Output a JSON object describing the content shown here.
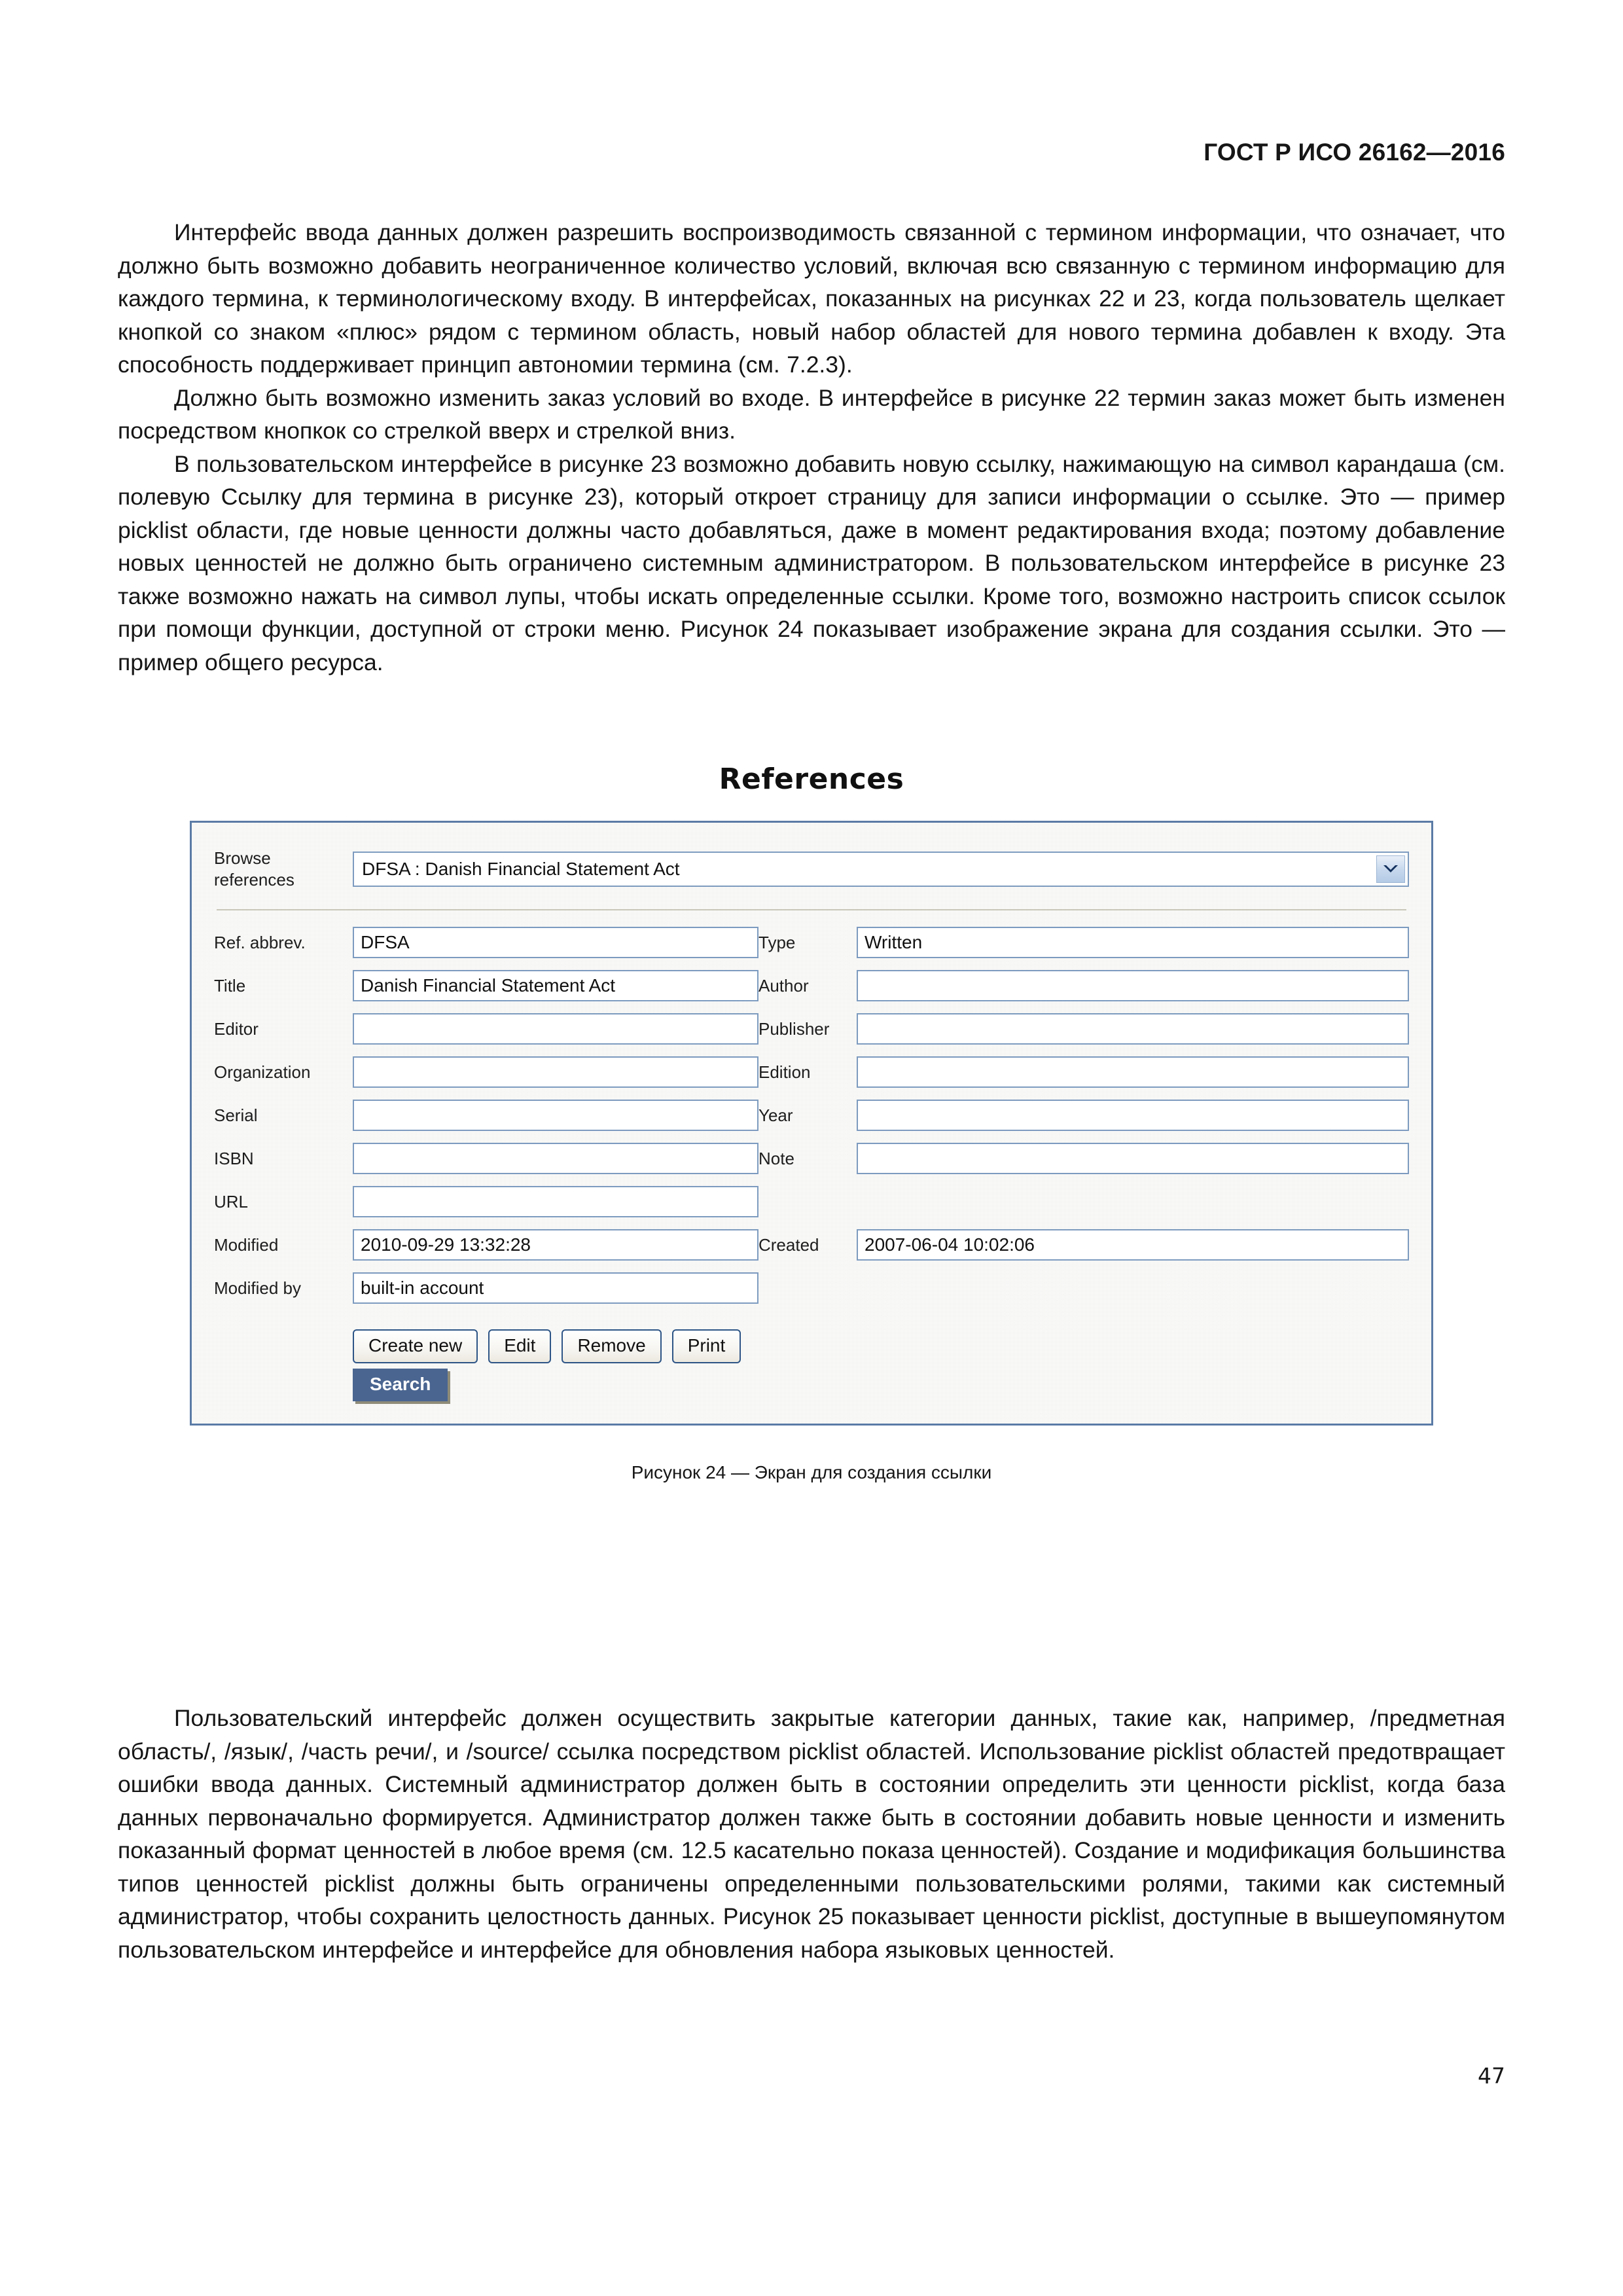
{
  "header": {
    "standard_title": "ГОСТ Р ИСО 26162—2016"
  },
  "body_paragraphs_top": [
    "Интерфейс ввода данных должен разрешить воспроизводимость связанной с термином информации, что означает, что должно быть возможно добавить неограниченное количество условий, включая всю связанную с термином информацию для каждого термина, к терминологическому входу. В интерфейсах, показанных на рисунках 22 и 23, когда пользователь щелкает кнопкой со знаком «плюс» рядом с термином область, новый набор областей для нового термина добавлен к входу. Эта способность поддерживает принцип автономии термина (см. 7.2.3).",
    "Должно быть возможно изменить заказ условий во входе. В интерфейсе в рисунке 22 термин заказ может быть изменен посредством кнопкок со стрелкой вверх и стрелкой вниз.",
    "В пользовательском интерфейсе в рисунке 23 возможно добавить новую ссылку, нажимающую на символ карандаша (см. полевую Ссылку для термина в рисунке 23), который откроет страницу для записи информации о ссылке. Это — пример picklist области, где новые ценности должны часто добавляться, даже в момент редактирования входа; поэтому добавление новых ценностей не должно быть ограничено системным администратором. В пользовательском интерфейсе в рисунке 23 также возможно нажать на символ лупы, чтобы искать определенные ссылки. Кроме того, возможно настроить список ссылок при помощи функции, доступной от строки меню. Рисунок 24 показывает изображение экрана для создания ссылки. Это — пример общего ресурса."
  ],
  "figure": {
    "title": "References",
    "caption": "Рисунок 24 — Экран для создания ссылки",
    "browse": {
      "label_line1": "Browse",
      "label_line2": "references",
      "selected_value": "DFSA : Danish Financial Statement Act",
      "arrow_icon": "chevron-down-icon"
    },
    "fields_left": [
      {
        "label": "Ref. abbrev.",
        "value": "DFSA"
      },
      {
        "label": "Title",
        "value": "Danish Financial Statement Act"
      },
      {
        "label": "Editor",
        "value": ""
      },
      {
        "label": "Organization",
        "value": ""
      },
      {
        "label": "Serial",
        "value": ""
      },
      {
        "label": "ISBN",
        "value": ""
      },
      {
        "label": "URL",
        "value": ""
      },
      {
        "label": "Modified",
        "value": "2010-09-29 13:32:28"
      },
      {
        "label": "Modified by",
        "value": "built-in account"
      }
    ],
    "fields_right": [
      {
        "label": "Type",
        "value": "Written"
      },
      {
        "label": "Author",
        "value": ""
      },
      {
        "label": "Publisher",
        "value": ""
      },
      {
        "label": "Edition",
        "value": ""
      },
      {
        "label": "Year",
        "value": ""
      },
      {
        "label": "Note",
        "value": ""
      },
      {
        "label": "",
        "value": ""
      },
      {
        "label": "Created",
        "value": "2007-06-04 10:02:06"
      },
      {
        "label": "",
        "value": ""
      }
    ],
    "buttons": [
      {
        "label": "Create new"
      },
      {
        "label": "Edit"
      },
      {
        "label": "Remove"
      },
      {
        "label": "Print"
      }
    ],
    "search_button": {
      "label": "Search"
    },
    "colors": {
      "panel_border": "#5a7ba6",
      "field_border": "#7d9bbf",
      "button_border": "#2e5586",
      "search_background": "#4a6590",
      "panel_background": "#f2f2f0"
    }
  },
  "body_paragraphs_bottom": [
    "Пользовательский интерфейс должен осуществить закрытые категории данных, такие как, например, /предметная область/, /язык/, /часть речи/, и /source/ ссылка посредством picklist областей. Использование picklist областей предотвращает ошибки ввода данных. Системный администратор должен быть в состоянии определить эти ценности picklist, когда база данных первоначально формируется. Администратор должен также быть в состоянии добавить новые ценности и изменить показанный формат ценностей в любое время (см. 12.5 касательно показа ценностей). Создание и модификация большинства типов ценностей picklist должны быть ограничены определенными пользовательскими ролями, такими как системный администратор, чтобы сохранить целостность данных. Рисунок 25 показывает ценности picklist, доступные в вышеупомянутом пользовательском интерфейсе и интерфейсе для обновления набора языковых ценностей."
  ],
  "footer": {
    "page_number": "47"
  }
}
